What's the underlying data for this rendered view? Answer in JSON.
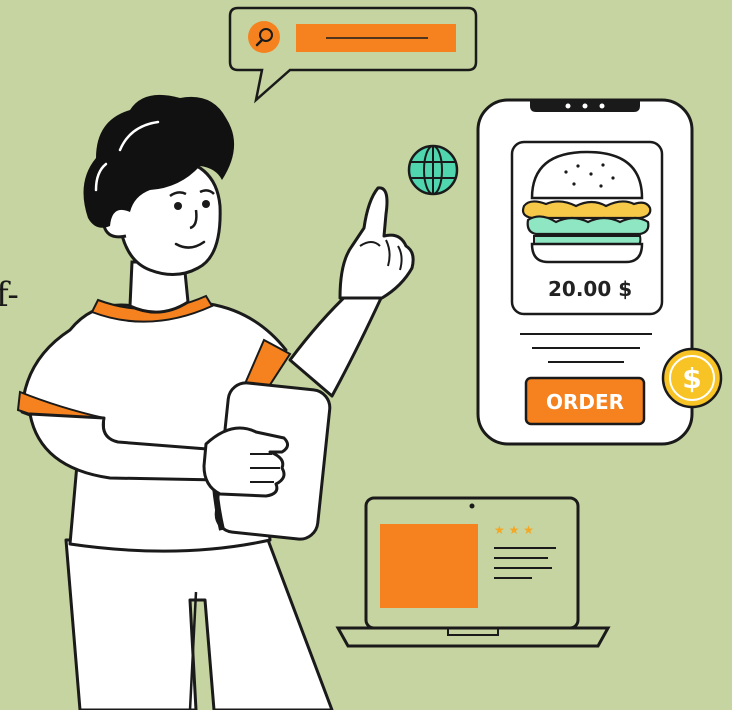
{
  "product": {
    "price_label": "20.00 $",
    "order_button_label": "ORDER"
  },
  "coin": {
    "symbol": "$"
  },
  "edge_text": "f-",
  "icons": {
    "search": "search-icon",
    "globe": "globe-icon",
    "coin": "dollar-coin-icon",
    "burger": "burger-icon"
  },
  "colors": {
    "background": "#c5d4a0",
    "accent": "#f5821f",
    "outline": "#1a1a1a",
    "white": "#ffffff",
    "hair": "#111111",
    "coin": "#f7c325",
    "globe": "#4fd6ae",
    "lettuce": "#8ee6c2",
    "cheese": "#f7c948"
  }
}
